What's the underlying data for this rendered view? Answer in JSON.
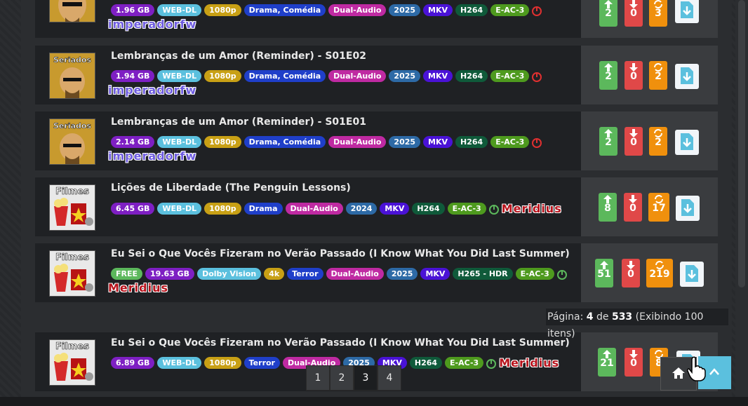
{
  "rows": [
    {
      "title": "",
      "thumb": "Seriados",
      "tags": [
        "1.96 GB",
        "WEB-DL",
        "1080p",
        "Drama, Comédia",
        "Dual-Audio",
        "2025",
        "MKV",
        "H264",
        "E-AC-3"
      ],
      "uploader": "imperadorfw",
      "seeders": "2",
      "leechers": "0",
      "completed": "3"
    },
    {
      "title": "Lembranças de um Amor (Reminder) - S01E02",
      "thumb": "Seriados",
      "tags": [
        "1.94 GB",
        "WEB-DL",
        "1080p",
        "Drama, Comédia",
        "Dual-Audio",
        "2025",
        "MKV",
        "H264",
        "E-AC-3"
      ],
      "uploader": "imperadorfw",
      "seeders": "2",
      "leechers": "0",
      "completed": "2"
    },
    {
      "title": "Lembranças de um Amor (Reminder) - S01E01",
      "thumb": "Seriados",
      "tags": [
        "2.14 GB",
        "WEB-DL",
        "1080p",
        "Drama, Comédia",
        "Dual-Audio",
        "2025",
        "MKV",
        "H264",
        "E-AC-3"
      ],
      "uploader": "imperadorfw",
      "seeders": "2",
      "leechers": "0",
      "completed": "2"
    },
    {
      "title": "Lições de Liberdade (The Penguin Lessons)",
      "thumb": "Filmes",
      "tags": [
        "6.45 GB",
        "WEB-DL",
        "1080p",
        "Drama",
        "Dual-Audio",
        "2024",
        "MKV",
        "H264",
        "E-AC-3"
      ],
      "uploader": "Meridius",
      "seeders": "8",
      "leechers": "0",
      "completed": "17"
    },
    {
      "title": "Eu Sei o Que Vocês Fizeram no Verão Passado (I Know What You Did Last Summer)",
      "thumb": "Filmes",
      "tags": [
        "FREE",
        "19.63 GB",
        "Dolby Vision",
        "4k",
        "Terror",
        "Dual-Audio",
        "2025",
        "MKV",
        "H265 - HDR",
        "E-AC-3"
      ],
      "uploader": "Meridius",
      "seeders": "51",
      "leechers": "0",
      "completed": "219"
    },
    {
      "title": "Eu Sei o Que Vocês Fizeram no Verão Passado (I Know What You Did Last Summer)",
      "thumb": "Filmes",
      "tags": [
        "6.89 GB",
        "WEB-DL",
        "1080p",
        "Terror",
        "Dual-Audio",
        "2025",
        "MKV",
        "H264",
        "E-AC-3"
      ],
      "uploader": "Meridius",
      "seeders": "21",
      "leechers": "0",
      "completed": "8"
    }
  ],
  "pager": {
    "label": "Página:",
    "current": "4",
    "of": "de",
    "total": "533",
    "showing": "(Exibindo 100 itens)",
    "pages": [
      "1",
      "2",
      "3",
      "4"
    ],
    "active_page": "3"
  },
  "colors": {
    "seeders": "#5cb85c",
    "leechers": "#e04848",
    "completed": "#f0900d",
    "accent": "#5bc0de"
  },
  "icons": {
    "home": "home-icon",
    "top": "chevron-up-icon",
    "download": "download-file-icon",
    "power": "power-icon"
  }
}
